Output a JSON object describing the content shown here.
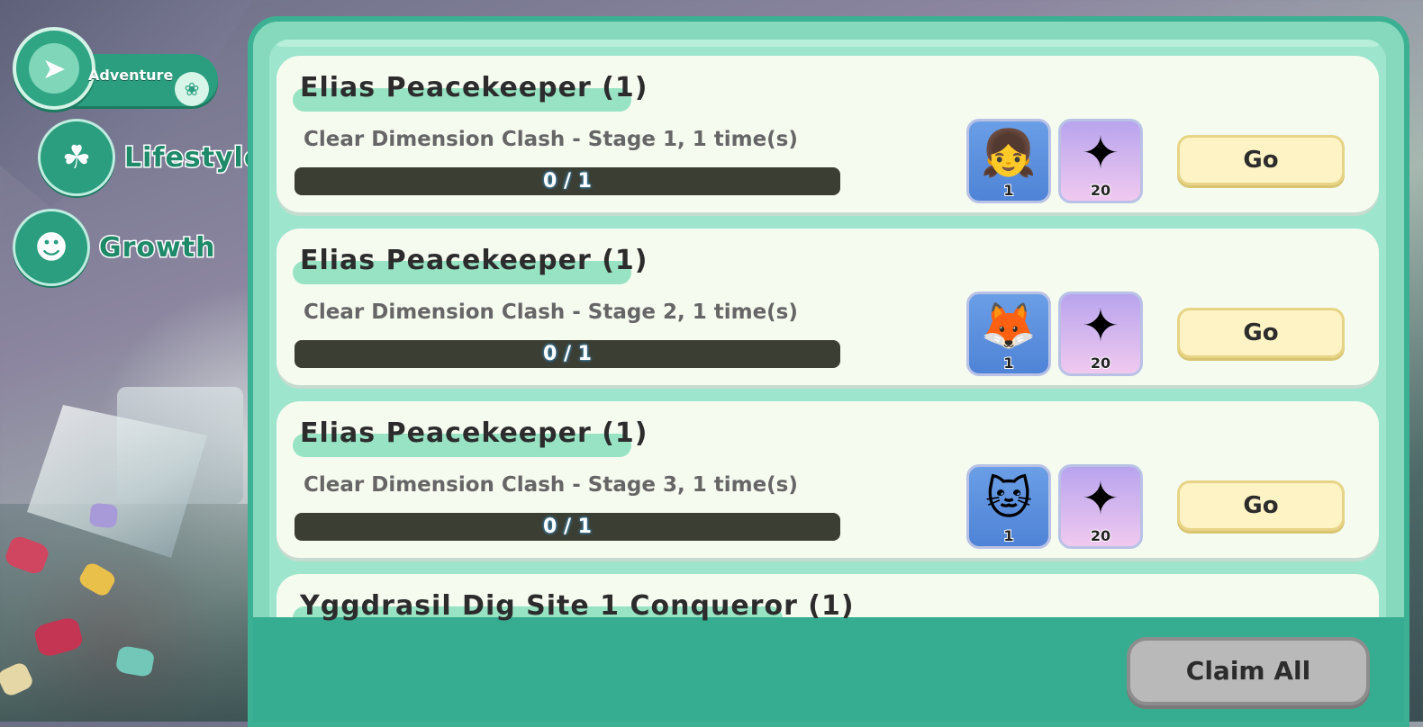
{
  "nav": {
    "adventure": {
      "label": "Adventure",
      "icon": "compass-icon"
    },
    "lifestyle": {
      "label": "Lifestyle",
      "icon": "clover-house-icon"
    },
    "growth": {
      "label": "Growth",
      "icon": "character-face-icon"
    }
  },
  "quests": [
    {
      "title": "Elias Peacekeeper (1)",
      "description": "Clear Dimension Clash - Stage 1, 1 time(s)",
      "progress": "0 / 1",
      "rewards": [
        {
          "icon": "green-hat-girl-avatar",
          "qty": "1"
        },
        {
          "icon": "rainbow-crystal-icon",
          "qty": "20"
        }
      ],
      "button": "Go"
    },
    {
      "title": "Elias Peacekeeper (1)",
      "description": "Clear Dimension Clash - Stage 2, 1 time(s)",
      "progress": "0 / 1",
      "rewards": [
        {
          "icon": "brown-fox-avatar",
          "qty": "1"
        },
        {
          "icon": "rainbow-crystal-icon",
          "qty": "20"
        }
      ],
      "button": "Go"
    },
    {
      "title": "Elias Peacekeeper (1)",
      "description": "Clear Dimension Clash - Stage 3, 1 time(s)",
      "progress": "0 / 1",
      "rewards": [
        {
          "icon": "white-cat-headset-avatar",
          "qty": "1"
        },
        {
          "icon": "rainbow-crystal-icon",
          "qty": "20"
        }
      ],
      "button": "Go"
    },
    {
      "title": "Yggdrasil Dig Site 1 Conqueror (1)"
    }
  ],
  "footer": {
    "claim_all": "Claim All"
  },
  "colors": {
    "accent": "#2a9e7e",
    "panel": "#86d9bd",
    "go_button": "#fdf3c4",
    "claim_disabled": "#b9b9b9"
  }
}
